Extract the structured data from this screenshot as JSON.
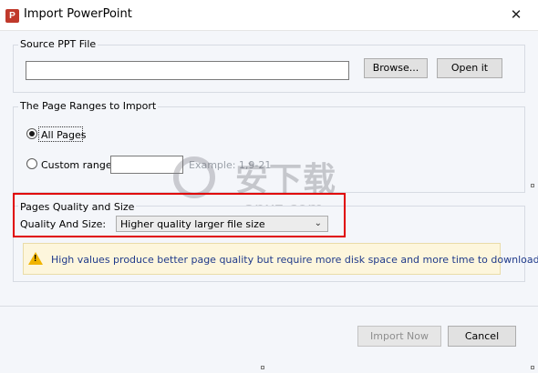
{
  "window": {
    "title": "Import PowerPoint",
    "close_glyph": "✕",
    "app_icon_glyph": "P",
    "app_icon": "powerpoint-icon"
  },
  "source": {
    "group_label": "Source PPT File",
    "file_path_value": "",
    "browse_label": "Browse...",
    "open_label": "Open it"
  },
  "ranges": {
    "group_label": "The Page Ranges to Import",
    "all_pages_label": "All Pages",
    "custom_range_label": "Custom range:",
    "custom_range_value": "",
    "example_text": "Example: 1,9-21",
    "selected": "all_pages"
  },
  "quality": {
    "group_label": "Pages Quality and Size",
    "field_label": "Quality And Size:",
    "selected_option": "Higher quality larger file size"
  },
  "info": {
    "icon": "warning-icon",
    "message": "High values produce better page quality but require more disk space and more time to download."
  },
  "footer": {
    "import_now_label": "Import Now",
    "cancel_label": "Cancel"
  },
  "watermark": {
    "text": "安下载",
    "sub": "anxz.com"
  },
  "colors": {
    "highlight": "#e00000",
    "warning": "#f0b400",
    "dialog_bg": "#f4f6fa"
  }
}
